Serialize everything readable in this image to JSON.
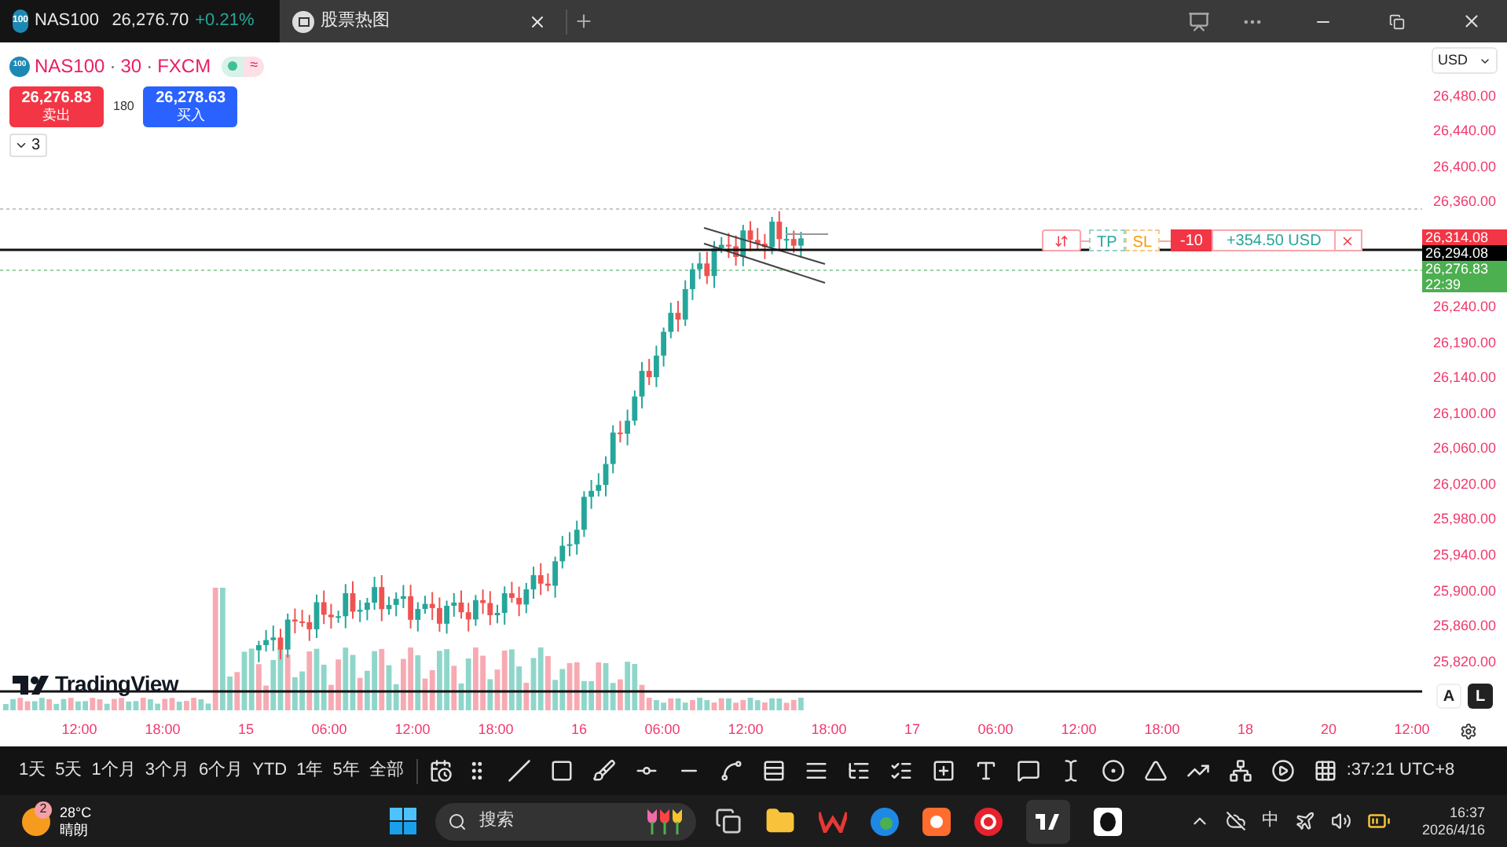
{
  "tabs": [
    {
      "title": "NAS100",
      "badge": "100",
      "price": "26,276.70",
      "change": "+0.21%",
      "selected": true
    },
    {
      "title": "股票热图",
      "selected": false
    }
  ],
  "symbol": {
    "badge": "100",
    "name": "NAS100",
    "interval": "30",
    "source": "FXCM",
    "separator": "·",
    "status_glyph": "≈",
    "sell_price": "26,276.83",
    "sell_label": "卖出",
    "spread": "180",
    "buy_price": "26,278.63",
    "buy_label": "买入",
    "indicators_count": "3"
  },
  "logo_text": "TradingView",
  "position": {
    "tp": "TP",
    "sl": "SL",
    "quantity": "-10",
    "pnl": "+354.50 USD"
  },
  "price_axis": {
    "currency": "USD",
    "labels": [
      "26,480.00",
      "26,440.00",
      "26,400.00",
      "26,360.00",
      "26,240.00",
      "26,190.00",
      "26,140.00",
      "26,100.00",
      "26,060.00",
      "26,020.00",
      "25,980.00",
      "25,940.00",
      "25,900.00",
      "25,860.00",
      "25,820.00"
    ],
    "markers": [
      {
        "kind": "position",
        "text": "26,314.08"
      },
      {
        "kind": "last",
        "text": "26,294.08"
      },
      {
        "kind": "bid",
        "text": "26,276.83",
        "countdown": "22:39"
      }
    ],
    "scale_buttons": [
      {
        "label": "A",
        "selected": false
      },
      {
        "label": "L",
        "selected": true
      }
    ]
  },
  "time_axis": [
    "12:00",
    "18:00",
    "15",
    "06:00",
    "12:00",
    "18:00",
    "16",
    "06:00",
    "12:00",
    "18:00",
    "17",
    "06:00",
    "12:00",
    "18:00",
    "18",
    "20",
    "12:00"
  ],
  "toolbar": {
    "periods": [
      "1天",
      "5天",
      "1个月",
      "3个月",
      "6个月",
      "YTD",
      "1年",
      "5年",
      "全部"
    ],
    "clock": ":37:21 UTC+8"
  },
  "taskbar": {
    "weather_badge": "2",
    "temperature": "28°C",
    "condition": "晴朗",
    "search_placeholder": "搜索",
    "ime": "中",
    "time": "16:37",
    "date": "2026/4/16"
  }
}
